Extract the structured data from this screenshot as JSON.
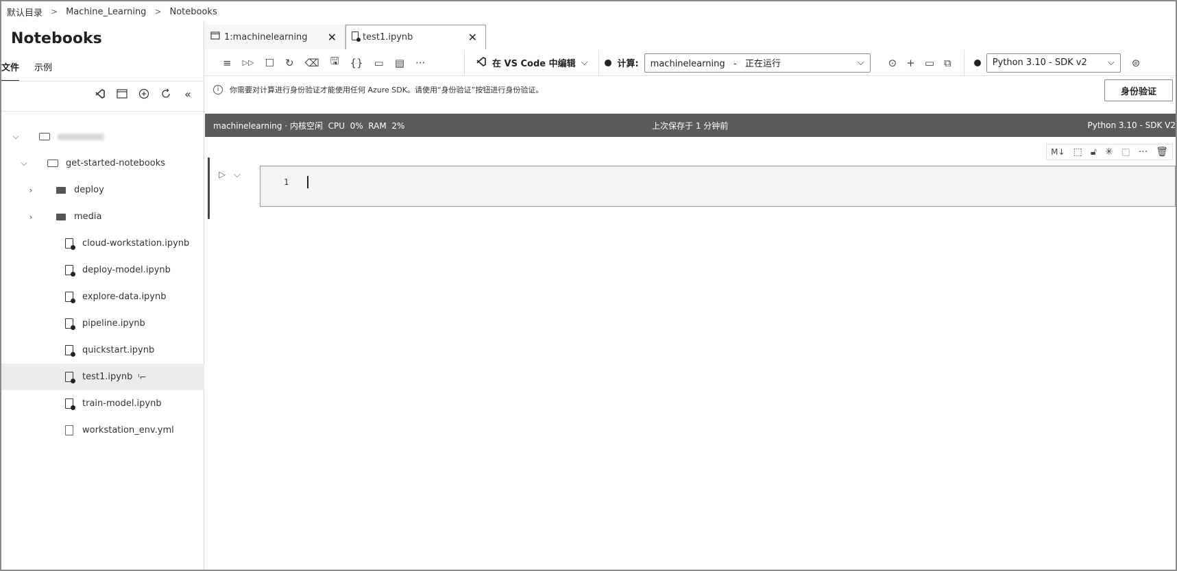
{
  "breadcrumb": [
    "默认目录",
    "Machine_Learning",
    "Notebooks"
  ],
  "sidebar": {
    "title": "Notebooks",
    "tabs": [
      {
        "label": "文件",
        "active": true
      },
      {
        "label": "示例",
        "active": false
      }
    ],
    "tools": [
      "vscode-icon",
      "terminal-icon",
      "add-icon",
      "refresh-icon",
      "collapse-icon"
    ],
    "tree": [
      {
        "type": "root",
        "label": "",
        "blurred": true
      },
      {
        "type": "folder-open",
        "label": "get-started-notebooks"
      },
      {
        "type": "folder",
        "label": "deploy"
      },
      {
        "type": "folder",
        "label": "media"
      },
      {
        "type": "file",
        "label": "cloud-workstation.ipynb"
      },
      {
        "type": "file",
        "label": "deploy-model.ipynb"
      },
      {
        "type": "file",
        "label": "explore-data.ipynb"
      },
      {
        "type": "file",
        "label": "pipeline.ipynb"
      },
      {
        "type": "file",
        "label": "quickstart.ipynb"
      },
      {
        "type": "file",
        "label": "test1.ipynb",
        "selected": true
      },
      {
        "type": "file",
        "label": "train-model.ipynb"
      },
      {
        "type": "file",
        "label": "workstation_env.yml"
      }
    ]
  },
  "tabs": [
    {
      "label": "1:machinelearning",
      "close": "✕"
    },
    {
      "label": "test1.ipynb",
      "close": "✕",
      "active": true
    }
  ],
  "toolbar": {
    "vscode_label": "在 VS Code 中编辑",
    "compute_label": "计算:",
    "compute_value": "machinelearning   -   正在运行",
    "kernel_value": "Python 3.10 - SDK v2"
  },
  "notice": {
    "text": "你需要对计算进行身份验证才能使用任何 Azure SDK。请使用“身份验证”按钮进行身份验证。",
    "button": "身份验证"
  },
  "status": {
    "left": "machinelearning · 内核空闲  CPU  0%  RAM  2%",
    "center": "上次保存于 1 分钟前",
    "right": "Python 3.10 - SDK V2"
  },
  "cell": {
    "line_number": "1",
    "tools_md": "M↓"
  }
}
